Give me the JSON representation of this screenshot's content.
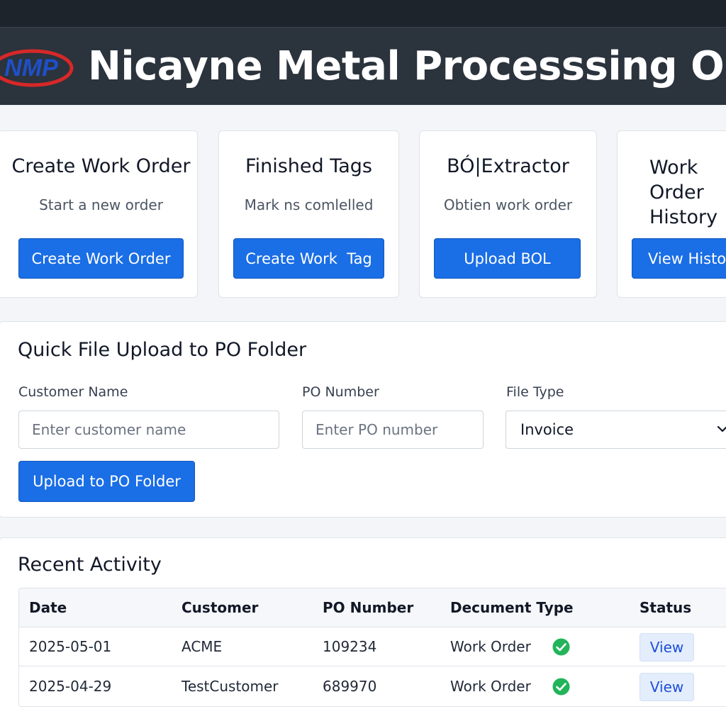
{
  "header": {
    "logo_text": "NMP",
    "title": "Nicayne Metal Processsing OS"
  },
  "cards": [
    {
      "title": "Create Work Order",
      "subtitle": "Start a new order",
      "button": "Create Work Order"
    },
    {
      "title": "Finished Tags",
      "subtitle": "Mark ns comlelled",
      "button": "Create Work  Tag"
    },
    {
      "title": "BÓ|Extractor",
      "subtitle": "Obtien work order",
      "button": "Upload BOL"
    },
    {
      "title_lines": [
        "Work",
        "Order",
        "History"
      ],
      "button": "View History"
    }
  ],
  "upload": {
    "title": "Quick File Upload to PO Folder",
    "customer_label": "Customer Name",
    "customer_placeholder": "Enter customer name",
    "po_label": "PO Number",
    "po_placeholder": "Enter PO number",
    "filetype_label": "File Type",
    "filetype_value": "Invoice",
    "button": "Upload to PO Folder"
  },
  "activity": {
    "title": "Recent Activity",
    "headers": [
      "Date",
      "Customer",
      "PO Number",
      "Decument Type",
      "Status"
    ],
    "rows": [
      {
        "date": "2025-05-01",
        "customer": "ACME",
        "po": "109234",
        "doc_type": "Work Order",
        "status_icon": "check-circle-icon",
        "action": "View"
      },
      {
        "date": "2025-04-29",
        "customer": "TestCustomer",
        "po": "689970",
        "doc_type": "Work Order",
        "status_icon": "check-circle-icon",
        "action": "View"
      }
    ]
  },
  "colors": {
    "header_bg": "#2b333d",
    "primary": "#1a6ee6",
    "success": "#22b45a",
    "logo_red": "#d62828",
    "logo_blue": "#1e50c8"
  }
}
